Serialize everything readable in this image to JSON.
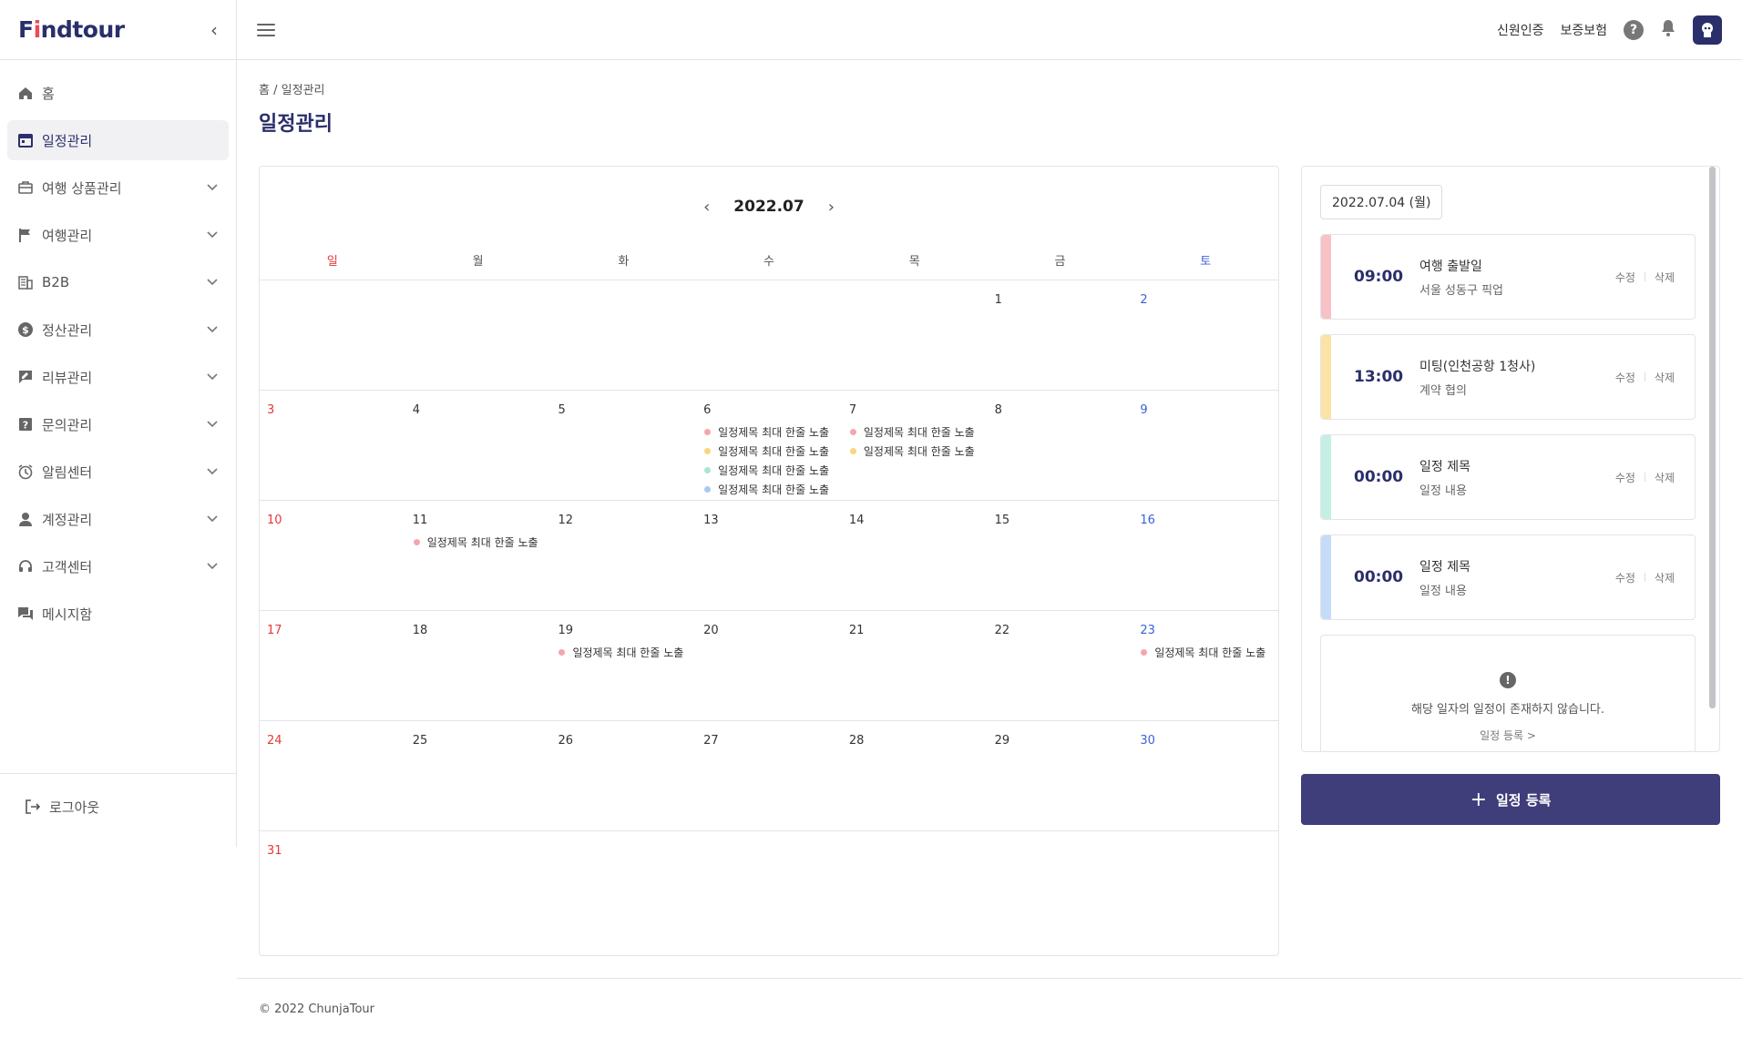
{
  "brand": {
    "logo_prefix": "F",
    "logo_mid": "i",
    "logo_suffix": "ndtour"
  },
  "sidebar": {
    "items": [
      {
        "label": "홈",
        "icon": "home-icon",
        "expandable": false,
        "active": false
      },
      {
        "label": "일정관리",
        "icon": "calendar-icon",
        "expandable": false,
        "active": true
      },
      {
        "label": "여행 상품관리",
        "icon": "briefcase-icon",
        "expandable": true,
        "active": false
      },
      {
        "label": "여행관리",
        "icon": "flag-icon",
        "expandable": true,
        "active": false
      },
      {
        "label": "B2B",
        "icon": "building-icon",
        "expandable": true,
        "active": false
      },
      {
        "label": "정산관리",
        "icon": "dollar-icon",
        "expandable": true,
        "active": false
      },
      {
        "label": "리뷰관리",
        "icon": "review-icon",
        "expandable": true,
        "active": false
      },
      {
        "label": "문의관리",
        "icon": "question-icon",
        "expandable": true,
        "active": false
      },
      {
        "label": "알림센터",
        "icon": "alarm-icon",
        "expandable": true,
        "active": false
      },
      {
        "label": "계정관리",
        "icon": "person-icon",
        "expandable": true,
        "active": false
      },
      {
        "label": "고객센터",
        "icon": "headset-icon",
        "expandable": true,
        "active": false
      },
      {
        "label": "메시지함",
        "icon": "chat-icon",
        "expandable": false,
        "active": false
      }
    ],
    "logout": "로그아웃"
  },
  "header": {
    "links": [
      "신원인증",
      "보증보험"
    ],
    "help": "?"
  },
  "breadcrumb": {
    "home": "홈",
    "sep": "/",
    "current": "일정관리"
  },
  "page_title": "일정관리",
  "calendar": {
    "month": "2022.07",
    "weekdays": [
      "일",
      "월",
      "화",
      "수",
      "목",
      "금",
      "토"
    ],
    "weeks": [
      [
        {
          "n": ""
        },
        {
          "n": ""
        },
        {
          "n": ""
        },
        {
          "n": ""
        },
        {
          "n": ""
        },
        {
          "n": "1"
        },
        {
          "n": "2"
        }
      ],
      [
        {
          "n": "3"
        },
        {
          "n": "4"
        },
        {
          "n": "5"
        },
        {
          "n": "6",
          "events": [
            {
              "t": "일정제목 최대 한줄 노출",
              "c": "#f4a6ae"
            },
            {
              "t": "일정제목 최대 한줄 노출",
              "c": "#f7d77e"
            },
            {
              "t": "일정제목 최대 한줄 노출",
              "c": "#a9e5d6"
            },
            {
              "t": "일정제목 최대 한줄 노출",
              "c": "#a9c9f0"
            }
          ]
        },
        {
          "n": "7",
          "events": [
            {
              "t": "일정제목 최대 한줄 노출",
              "c": "#f4a6ae"
            },
            {
              "t": "일정제목 최대 한줄 노출",
              "c": "#f7d77e"
            }
          ]
        },
        {
          "n": "8"
        },
        {
          "n": "9"
        }
      ],
      [
        {
          "n": "10"
        },
        {
          "n": "11",
          "events": [
            {
              "t": "일정제목 최대 한줄 노출",
              "c": "#f4a6ae"
            }
          ]
        },
        {
          "n": "12"
        },
        {
          "n": "13"
        },
        {
          "n": "14"
        },
        {
          "n": "15"
        },
        {
          "n": "16"
        }
      ],
      [
        {
          "n": "17"
        },
        {
          "n": "18"
        },
        {
          "n": "19",
          "events": [
            {
              "t": "일정제목 최대 한줄 노출",
              "c": "#f4a6ae"
            }
          ]
        },
        {
          "n": "20"
        },
        {
          "n": "21"
        },
        {
          "n": "22"
        },
        {
          "n": "23",
          "events": [
            {
              "t": "일정제목 최대 한줄 노출",
              "c": "#f4a6ae"
            }
          ]
        }
      ],
      [
        {
          "n": "24"
        },
        {
          "n": "25"
        },
        {
          "n": "26"
        },
        {
          "n": "27"
        },
        {
          "n": "28"
        },
        {
          "n": "29"
        },
        {
          "n": "30"
        }
      ],
      [
        {
          "n": "31"
        },
        {
          "n": ""
        },
        {
          "n": ""
        },
        {
          "n": ""
        },
        {
          "n": ""
        },
        {
          "n": ""
        },
        {
          "n": ""
        }
      ]
    ]
  },
  "schedule": {
    "date": "2022.07.04 (월)",
    "items": [
      {
        "time": "09:00",
        "title": "여행 출발일",
        "sub": "서울 성동구 픽업",
        "color": "#f7c1c6"
      },
      {
        "time": "13:00",
        "title": "미팅(인천공항 1청사)",
        "sub": "계약 협의",
        "color": "#fbe3a6"
      },
      {
        "time": "00:00",
        "title": "일정 제목",
        "sub": "일정 내용",
        "color": "#c3efe5"
      },
      {
        "time": "00:00",
        "title": "일정 제목",
        "sub": "일정 내용",
        "color": "#c4dcf7"
      }
    ],
    "edit": "수정",
    "delete": "삭제",
    "empty_msg": "해당 일자의 일정이 존재하지 않습니다.",
    "empty_link": "일정 등록 >",
    "add_button": "일정 등록"
  },
  "footer": {
    "copyright": "© 2022 ChunjaTour"
  },
  "colors": {
    "brand": "#2a2f6b",
    "accent": "#3f3d7a",
    "sunday": "#e53935",
    "saturday": "#3a62d7"
  }
}
